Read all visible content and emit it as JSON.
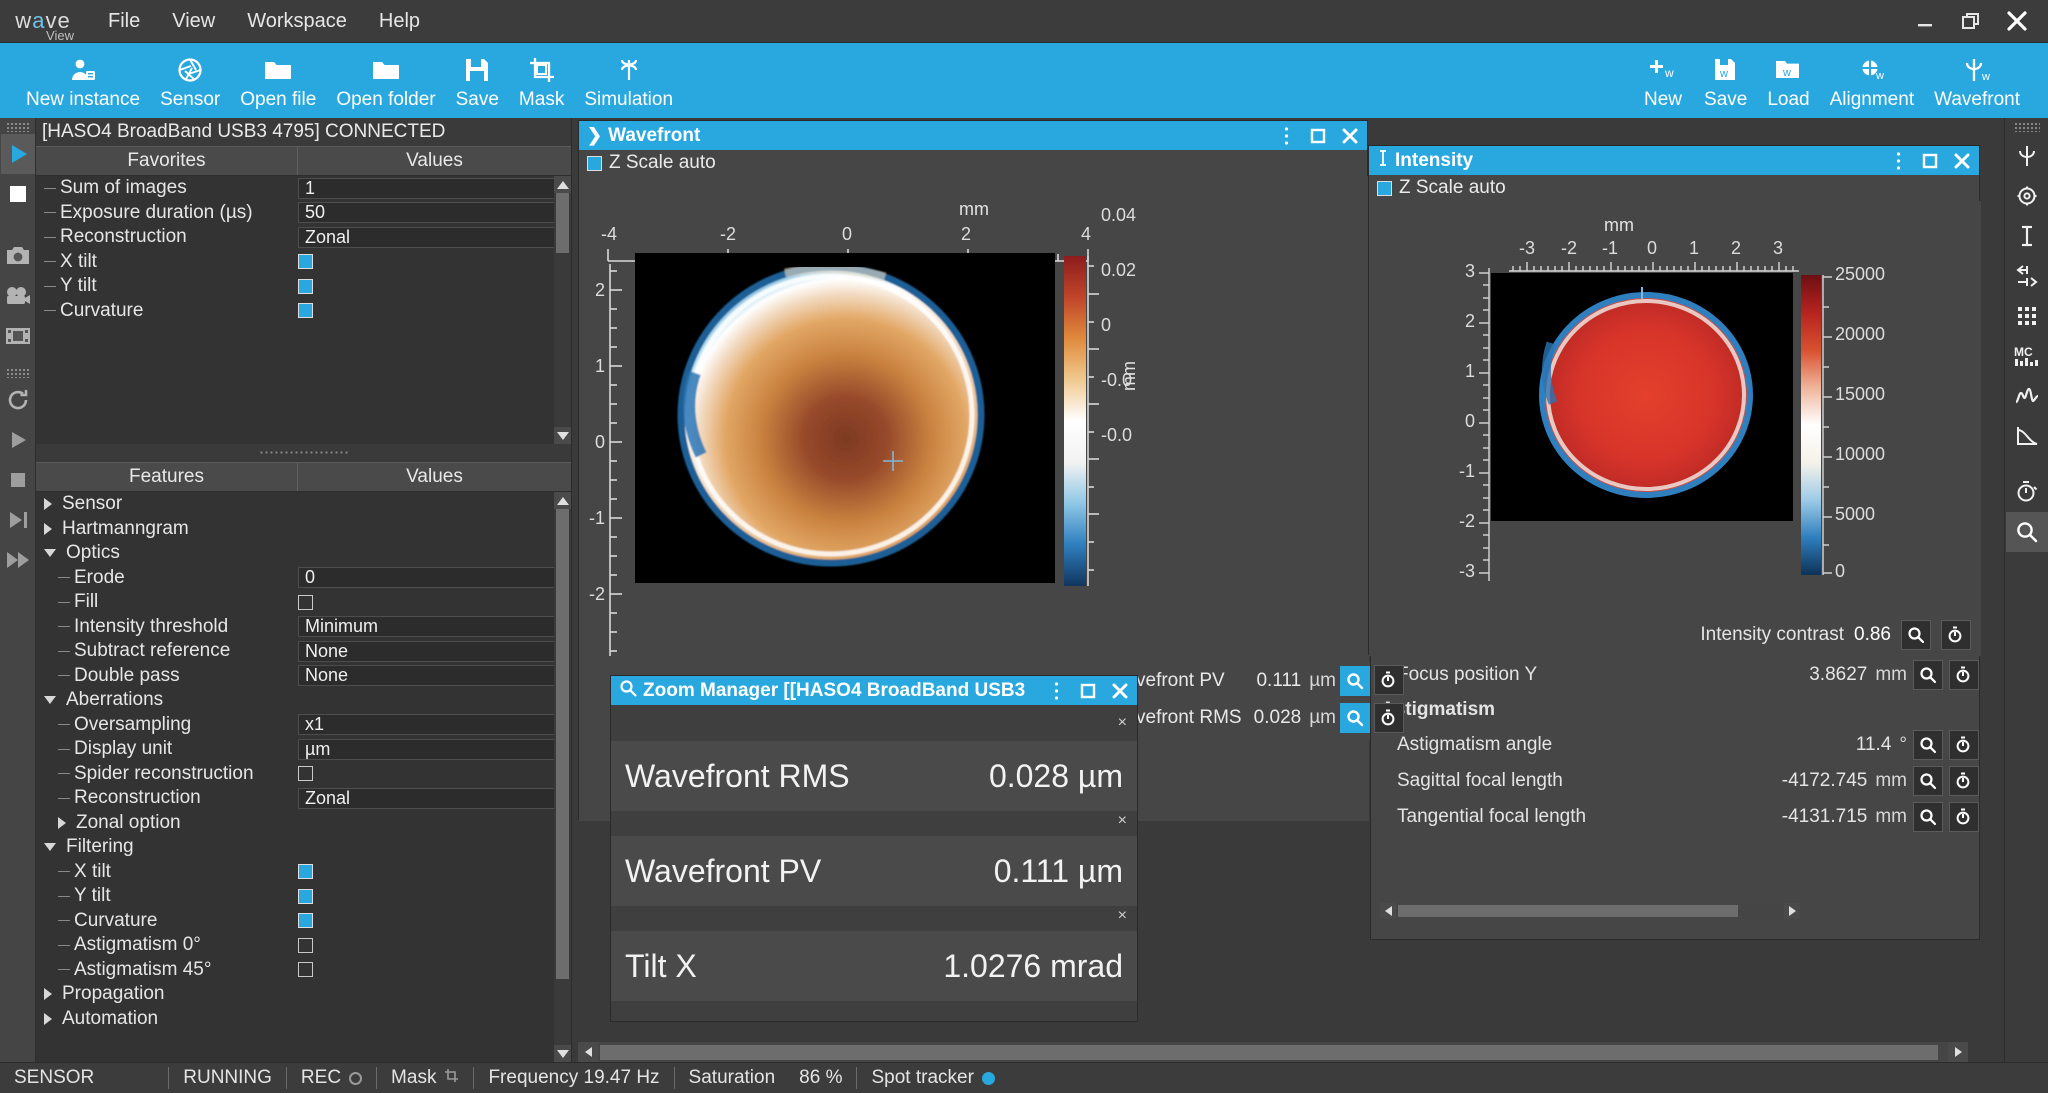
{
  "app": {
    "logo_main": "wave",
    "logo_sub": "View",
    "menu": [
      "File",
      "View",
      "Workspace",
      "Help"
    ]
  },
  "window_controls": [
    {
      "name": "minimize-button",
      "glyph": "minimize"
    },
    {
      "name": "restore-button",
      "glyph": "restore"
    },
    {
      "name": "close-button",
      "glyph": "close"
    }
  ],
  "ribbon": {
    "left": [
      {
        "label": "New instance",
        "icon": "new-instance-icon"
      },
      {
        "label": "Sensor",
        "icon": "sensor-aperture-icon"
      },
      {
        "label": "Open file",
        "icon": "open-file-icon"
      },
      {
        "label": "Open folder",
        "icon": "open-folder-icon"
      },
      {
        "label": "Save",
        "icon": "save-floppy-icon"
      },
      {
        "label": "Mask",
        "icon": "mask-crop-icon"
      },
      {
        "label": "Simulation",
        "icon": "simulation-icon"
      }
    ],
    "right": [
      {
        "label": "New",
        "icon": "new-wavefront-icon"
      },
      {
        "label": "Save",
        "icon": "save-wavefront-icon"
      },
      {
        "label": "Load",
        "icon": "load-wavefront-icon"
      },
      {
        "label": "Alignment",
        "icon": "alignment-icon"
      },
      {
        "label": "Wavefront",
        "icon": "wavefront-psi-icon"
      }
    ]
  },
  "left_strip": [
    {
      "name": "play-acquisition-icon",
      "selected": true
    },
    {
      "name": "stop-acquisition-icon",
      "selected": false
    },
    {
      "name": "camera-snapshot-icon",
      "selected": false
    },
    {
      "name": "movie-camera-icon",
      "selected": false
    },
    {
      "name": "film-strip-icon",
      "selected": false
    },
    {
      "name": "reset-loop-icon",
      "selected": false
    },
    {
      "name": "play-playback-icon",
      "selected": false
    },
    {
      "name": "stop-playback-icon",
      "selected": false
    },
    {
      "name": "step-forward-icon",
      "selected": false
    },
    {
      "name": "fast-forward-icon",
      "selected": false
    }
  ],
  "right_strip": [
    {
      "name": "wavefront-psi-icon",
      "selected": false
    },
    {
      "name": "settings-gear-icon",
      "selected": false
    },
    {
      "name": "intensity-icon",
      "selected": false
    },
    {
      "name": "slopes-icon",
      "selected": false
    },
    {
      "name": "spot-grid-icon",
      "selected": false
    },
    {
      "name": "modal-coefficients-icon",
      "selected": false
    },
    {
      "name": "psf-profile-icon",
      "selected": false
    },
    {
      "name": "mtf-curve-icon",
      "selected": false
    },
    {
      "name": "chrono-icon",
      "selected": false
    },
    {
      "name": "zoom-manager-icon",
      "selected": true
    }
  ],
  "left_dock": {
    "device_status": "[HASO4 BroadBand USB3 4795] CONNECTED",
    "favorites": {
      "col_name": "Favorites",
      "col_value": "Values",
      "rows": [
        {
          "label": "Sum of images",
          "type": "spin",
          "value": "1"
        },
        {
          "label": "Exposure duration (µs)",
          "type": "spin",
          "value": "50"
        },
        {
          "label": "Reconstruction",
          "type": "combo",
          "value": "Zonal"
        },
        {
          "label": "X tilt",
          "type": "check",
          "checked": true
        },
        {
          "label": "Y tilt",
          "type": "check",
          "checked": true
        },
        {
          "label": "Curvature",
          "type": "check",
          "checked": true
        }
      ]
    },
    "features": {
      "col_name": "Features",
      "col_value": "Values",
      "rows": [
        {
          "label": "Sensor",
          "type": "group",
          "expanded": false,
          "level": 0
        },
        {
          "label": "Hartmanngram",
          "type": "group",
          "expanded": false,
          "level": 0
        },
        {
          "label": "Optics",
          "type": "group",
          "expanded": true,
          "level": 0
        },
        {
          "label": "Erode",
          "type": "spin",
          "value": "0",
          "level": 1
        },
        {
          "label": "Fill",
          "type": "check",
          "checked": false,
          "level": 1
        },
        {
          "label": "Intensity threshold",
          "type": "combo",
          "value": "Minimum",
          "level": 1
        },
        {
          "label": "Subtract reference",
          "type": "combo",
          "value": "None",
          "level": 1
        },
        {
          "label": "Double pass",
          "type": "combo",
          "value": "None",
          "level": 1
        },
        {
          "label": "Aberrations",
          "type": "group",
          "expanded": true,
          "level": 0
        },
        {
          "label": "Oversampling",
          "type": "combo",
          "value": "x1",
          "level": 1
        },
        {
          "label": "Display unit",
          "type": "combo",
          "value": "µm",
          "level": 1
        },
        {
          "label": "Spider reconstruction",
          "type": "check",
          "checked": false,
          "level": 1
        },
        {
          "label": "Reconstruction",
          "type": "combo",
          "value": "Zonal",
          "level": 1
        },
        {
          "label": "Zonal option",
          "type": "group",
          "expanded": false,
          "level": 1
        },
        {
          "label": "Filtering",
          "type": "group",
          "expanded": true,
          "level": 0
        },
        {
          "label": "X tilt",
          "type": "check",
          "checked": true,
          "level": 1
        },
        {
          "label": "Y tilt",
          "type": "check",
          "checked": true,
          "level": 1
        },
        {
          "label": "Curvature",
          "type": "check",
          "checked": true,
          "level": 1
        },
        {
          "label": "Astigmatism 0°",
          "type": "check",
          "checked": false,
          "level": 1
        },
        {
          "label": "Astigmatism 45°",
          "type": "check",
          "checked": false,
          "level": 1
        },
        {
          "label": "Propagation",
          "type": "group",
          "expanded": false,
          "level": 0
        },
        {
          "label": "Automation",
          "type": "group",
          "expanded": false,
          "level": 0
        }
      ]
    }
  },
  "wavefront_panel": {
    "title": "Wavefront",
    "zscale_label": "Z Scale auto",
    "zscale_checked": true,
    "x_unit": "mm",
    "y_unit": "mm",
    "cbar_unit": "mm",
    "x_ticks": [
      "-4",
      "-2",
      "0",
      "2",
      "4"
    ],
    "y_ticks": [
      "2",
      "1",
      "0",
      "-1",
      "-2"
    ],
    "cbar_ticks": [
      "0.04",
      "0.02",
      "0",
      "-0.0",
      "-0.0"
    ]
  },
  "intensity_panel": {
    "title": "Intensity",
    "zscale_label": "Z Scale auto",
    "zscale_checked": true,
    "x_unit": "mm",
    "y_unit": "mm",
    "x_ticks": [
      "-3",
      "-2",
      "-1",
      "0",
      "1",
      "2",
      "3"
    ],
    "y_ticks": [
      "3",
      "2",
      "1",
      "0",
      "-1",
      "-2",
      "-3"
    ],
    "cbar_ticks": [
      "25000",
      "20000",
      "15000",
      "10000",
      "5000",
      "0"
    ],
    "contrast_label": "Intensity contrast",
    "contrast_value": "0.86"
  },
  "results_panel": {
    "hidden_rows": [
      {
        "label": "vefront PV",
        "value": "0.111",
        "unit": "µm"
      },
      {
        "label": "vefront RMS",
        "value": "0.028",
        "unit": "µm"
      }
    ],
    "focus_row": {
      "label": "Focus position Y",
      "value": "3.8627",
      "unit": "mm"
    },
    "group_title": "Astigmatism",
    "rows": [
      {
        "label": "Astigmatism angle",
        "value": "11.4",
        "unit": "°"
      },
      {
        "label": "Sagittal focal length",
        "value": "-4172.745",
        "unit": "mm"
      },
      {
        "label": "Tangential focal length",
        "value": "-4131.715",
        "unit": "mm"
      }
    ]
  },
  "zoom_manager": {
    "title": "Zoom Manager [[HASO4 BroadBand USB3",
    "items": [
      {
        "label": "Wavefront RMS",
        "value": "0.028 µm"
      },
      {
        "label": "Wavefront PV",
        "value": "0.111 µm"
      },
      {
        "label": "Tilt X",
        "value": "1.0276 mrad"
      }
    ],
    "close_glyph": "×"
  },
  "status_bar": {
    "sensor": "SENSOR",
    "running": "RUNNING",
    "rec": "REC",
    "mask": "Mask",
    "frequency": "Frequency 19.47 Hz",
    "saturation_label": "Saturation",
    "saturation_value": "86 %",
    "spot_tracker": "Spot tracker"
  },
  "colors": {
    "accent": "#29a8df",
    "panel_bg": "#3f3f3f",
    "app_bg": "#3a3a3a",
    "text": "#e8e8e8"
  }
}
